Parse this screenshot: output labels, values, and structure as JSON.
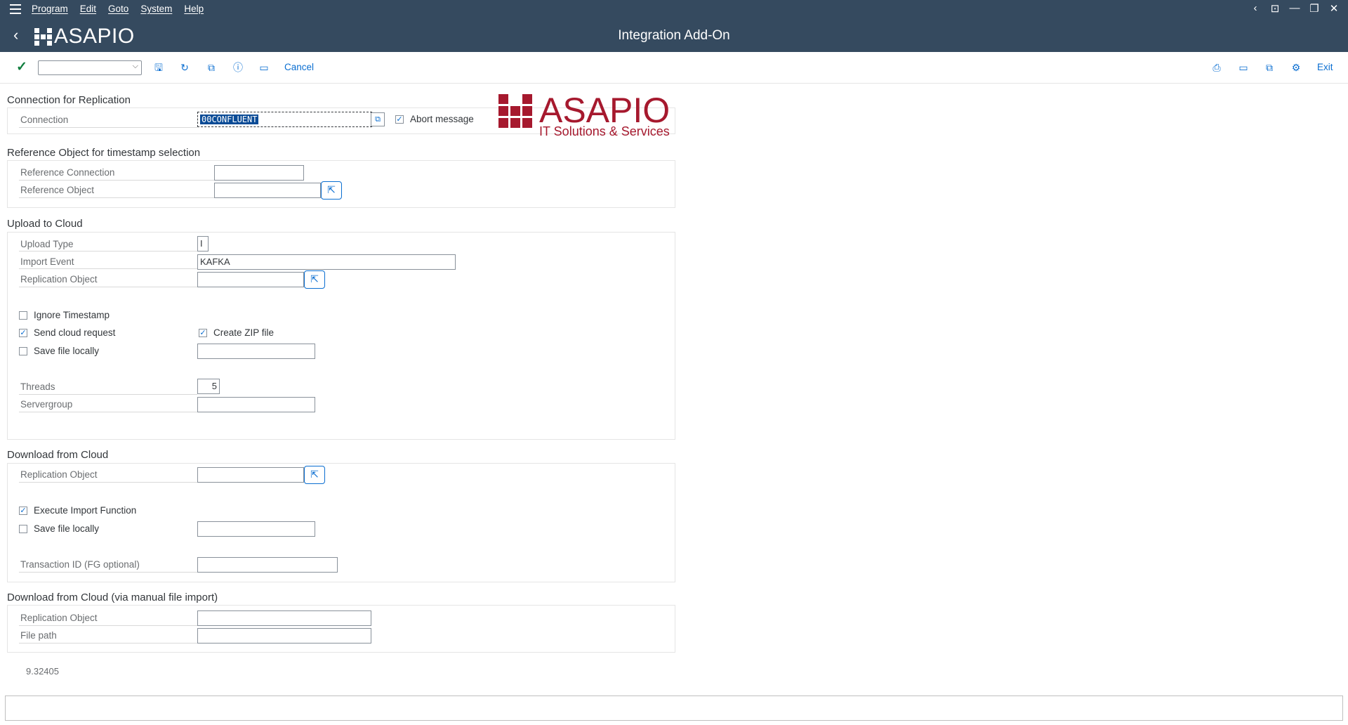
{
  "menubar": {
    "items": [
      "Program",
      "Edit",
      "Goto",
      "System",
      "Help"
    ]
  },
  "header": {
    "logo_text": "ASAPIO",
    "title": "Integration Add-On"
  },
  "toolbar": {
    "combo_value": "",
    "cancel_label": "Cancel",
    "exit_label": "Exit"
  },
  "connection": {
    "section_title": "Connection for Replication",
    "connection_label": "Connection",
    "connection_value": "00CONFLUENT",
    "abort_message_label": "Abort message",
    "abort_message_checked": true
  },
  "logo_block": {
    "brand": "ASAPIO",
    "tagline": "IT Solutions & Services"
  },
  "reference": {
    "section_title": "Reference Object for timestamp selection",
    "ref_connection_label": "Reference Connection",
    "ref_connection_value": "",
    "ref_object_label": "Reference Object",
    "ref_object_value": ""
  },
  "upload": {
    "section_title": "Upload to Cloud",
    "upload_type_label": "Upload Type",
    "upload_type_value": "I",
    "import_event_label": "Import Event",
    "import_event_value": "KAFKA",
    "replication_object_label": "Replication Object",
    "replication_object_value": "",
    "ignore_timestamp_label": "Ignore Timestamp",
    "ignore_timestamp_checked": false,
    "send_cloud_request_label": "Send cloud request",
    "send_cloud_request_checked": true,
    "create_zip_label": "Create ZIP file",
    "create_zip_checked": true,
    "save_file_locally_label": "Save file locally",
    "save_file_locally_checked": false,
    "save_file_path_value": "",
    "threads_label": "Threads",
    "threads_value": "5",
    "servergroup_label": "Servergroup",
    "servergroup_value": ""
  },
  "download": {
    "section_title": "Download from Cloud",
    "replication_object_label": "Replication Object",
    "replication_object_value": "",
    "execute_import_label": "Execute Import Function",
    "execute_import_checked": true,
    "save_file_locally_label": "Save file locally",
    "save_file_locally_checked": false,
    "save_file_path_value": "",
    "transaction_id_label": "Transaction ID (FG optional)",
    "transaction_id_value": ""
  },
  "manual_import": {
    "section_title": "Download from Cloud (via manual file import)",
    "replication_object_label": "Replication Object",
    "replication_object_value": "",
    "file_path_label": "File path",
    "file_path_value": ""
  },
  "version": "9.32405",
  "status": ""
}
